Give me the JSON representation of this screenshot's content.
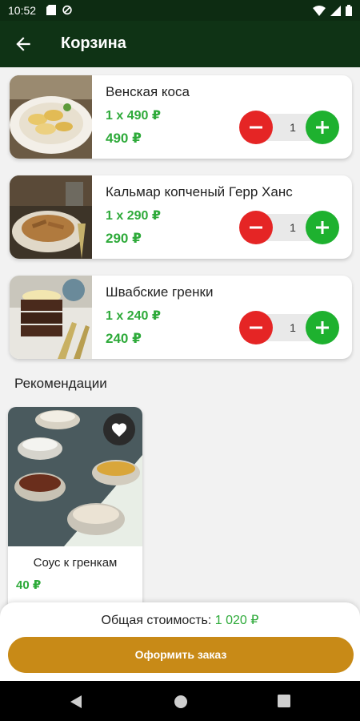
{
  "status_bar": {
    "time": "10:52"
  },
  "app_bar": {
    "title": "Корзина"
  },
  "cart": {
    "items": [
      {
        "name": "Венская коса",
        "unit_price": "1 x 490 ₽",
        "total": "490 ₽",
        "quantity": "1"
      },
      {
        "name": "Кальмар копченый Герр Ханс",
        "unit_price": "1 x 290 ₽",
        "total": "290 ₽",
        "quantity": "1"
      },
      {
        "name": "Швабские гренки",
        "unit_price": "1 x 240 ₽",
        "total": "240 ₽",
        "quantity": "1"
      }
    ]
  },
  "recommendations": {
    "title": "Рекомендации",
    "items": [
      {
        "name": "Соус к гренкам",
        "price": "40 ₽"
      }
    ]
  },
  "summary": {
    "label": "Общая стоимость:",
    "value": "1 020 ₽",
    "order_button": "Оформить заказ"
  },
  "colors": {
    "app_bar": "#0f3315",
    "price_green": "#2eaa3a",
    "minus_red": "#e52525",
    "plus_green": "#1eb12f",
    "order_button": "#c88a17"
  }
}
